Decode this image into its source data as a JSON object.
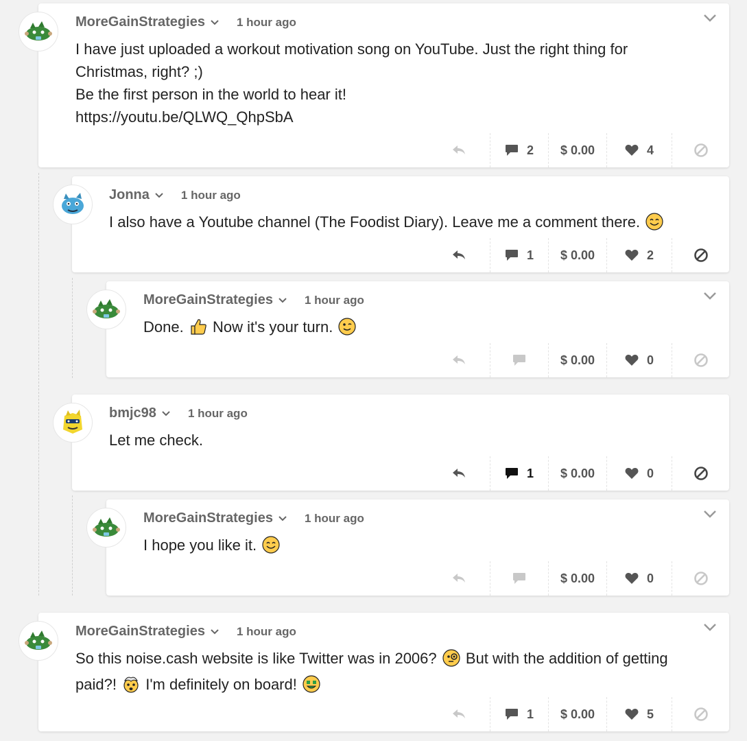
{
  "colors": {
    "background": "#f2f2f2",
    "card": "#ffffff",
    "username": "#666666",
    "text": "#222222",
    "icon_active": "#555555",
    "icon_muted": "#c8c8c8",
    "avatar_green": "#3a8a3a",
    "avatar_blue": "#4aa7d8",
    "avatar_yellow": "#f2d62e"
  },
  "posts": [
    {
      "user": "MoreGainStrategies",
      "time": "1 hour ago",
      "avatar": "green-dragon-avatar",
      "line1": "I have just uploaded a workout motivation song on YouTube. Just the right thing for",
      "line2": "Christmas, right? ;)",
      "line3": "Be the first person in the world to hear it!",
      "line4": "https://youtu.be/QLWQ_QhpSbA",
      "comments": "2",
      "tip": "$ 0.00",
      "likes": "4"
    },
    {
      "user": "Jonna",
      "time": "1 hour ago",
      "avatar": "blue-dragon-avatar",
      "text": "I also have a Youtube channel (The Foodist Diary). Leave me a comment there.",
      "emoji": "smiling-face-emoji",
      "comments": "1",
      "tip": "$ 0.00",
      "likes": "2"
    },
    {
      "user": "MoreGainStrategies",
      "time": "1 hour ago",
      "avatar": "green-dragon-avatar",
      "text_a": "Done.",
      "emoji_a": "thumbs-up-emoji",
      "text_b": "Now it's your turn.",
      "emoji_b": "winking-face-emoji",
      "tip": "$ 0.00",
      "likes": "0"
    },
    {
      "user": "bmjc98",
      "time": "1 hour ago",
      "avatar": "yellow-dragon-avatar",
      "text": "Let me check.",
      "comments": "1",
      "tip": "$ 0.00",
      "likes": "0"
    },
    {
      "user": "MoreGainStrategies",
      "time": "1 hour ago",
      "avatar": "green-dragon-avatar",
      "text": "I hope you like it.",
      "emoji": "smiling-face-emoji",
      "tip": "$ 0.00",
      "likes": "0"
    },
    {
      "user": "MoreGainStrategies",
      "time": "1 hour ago",
      "avatar": "green-dragon-avatar",
      "text_a": "So this noise.cash website is like Twitter was in 2006?",
      "emoji_a": "face-with-monocle-emoji",
      "text_b": "But with the addition of getting",
      "text_c": "paid?!",
      "emoji_c": "exploding-head-emoji",
      "text_d": "I'm definitely on board!",
      "emoji_d": "money-mouth-face-emoji",
      "comments": "1",
      "tip": "$ 0.00",
      "likes": "5"
    }
  ]
}
